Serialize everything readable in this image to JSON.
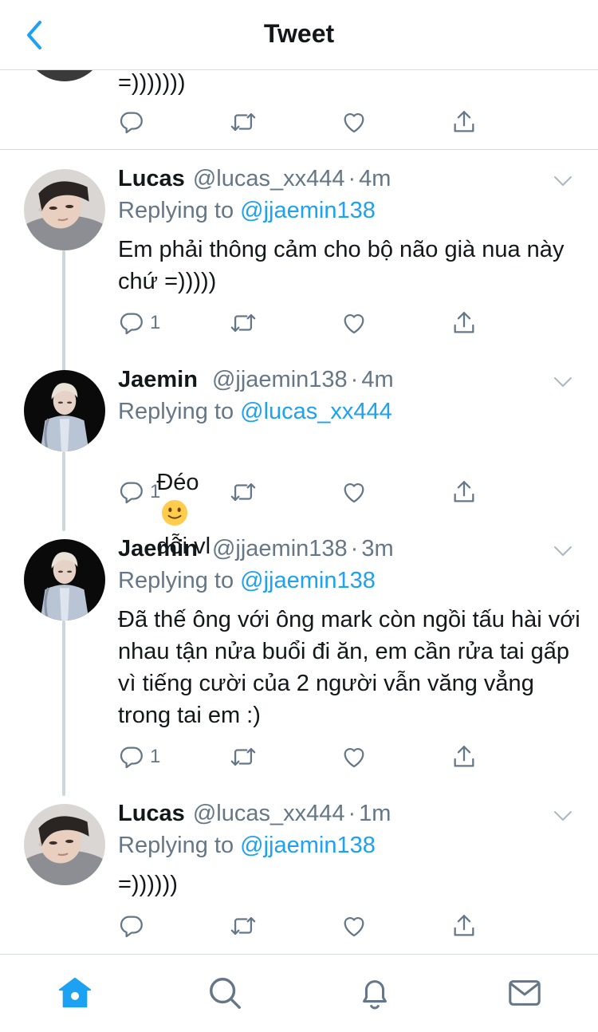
{
  "header": {
    "title": "Tweet",
    "back_icon": "chevron-left-icon"
  },
  "colors": {
    "accent": "#1da1f2",
    "secondary_text": "#657786",
    "icon_gray": "#657786",
    "divider": "#d8dde1"
  },
  "top_partial_tweet": {
    "text": "=)))))))"
  },
  "tweets": [
    {
      "name": "Lucas",
      "handle": "@lucas_xx444",
      "time": "4m",
      "replying_label": "Replying to",
      "replying_to": "@jjaemin138",
      "text": "Em phải thông cảm cho bộ não già nua này chứ =)))))",
      "reply_count": "1"
    },
    {
      "name": "Jaemin",
      "handle": "@jjaemin138",
      "time": "4m",
      "replying_label": "Replying to",
      "replying_to": "@lucas_xx444",
      "text_before_emoji": "Đéo",
      "text_after_emoji": "dỗi vl",
      "emoji": "slightly-smiling-face",
      "reply_count": "1"
    },
    {
      "name": "Jaemin",
      "handle": "@jjaemin138",
      "time": "3m",
      "replying_label": "Replying to",
      "replying_to": "@jjaemin138",
      "text": "Đã thế ông với ông mark còn ngồi tấu hài với nhau tận nửa buổi đi ăn, em cần rửa tai gấp vì tiếng cười của 2 người vẫn văng vẳng trong tai em :)",
      "reply_count": "1"
    },
    {
      "name": "Lucas",
      "handle": "@lucas_xx444",
      "time": "1m",
      "replying_label": "Replying to",
      "replying_to": "@jjaemin138",
      "text": "=))))))",
      "reply_count": ""
    }
  ],
  "dot": "·",
  "tabbar": {
    "items": [
      "home-icon",
      "search-icon",
      "notifications-icon",
      "messages-icon"
    ],
    "active": "home-icon"
  }
}
